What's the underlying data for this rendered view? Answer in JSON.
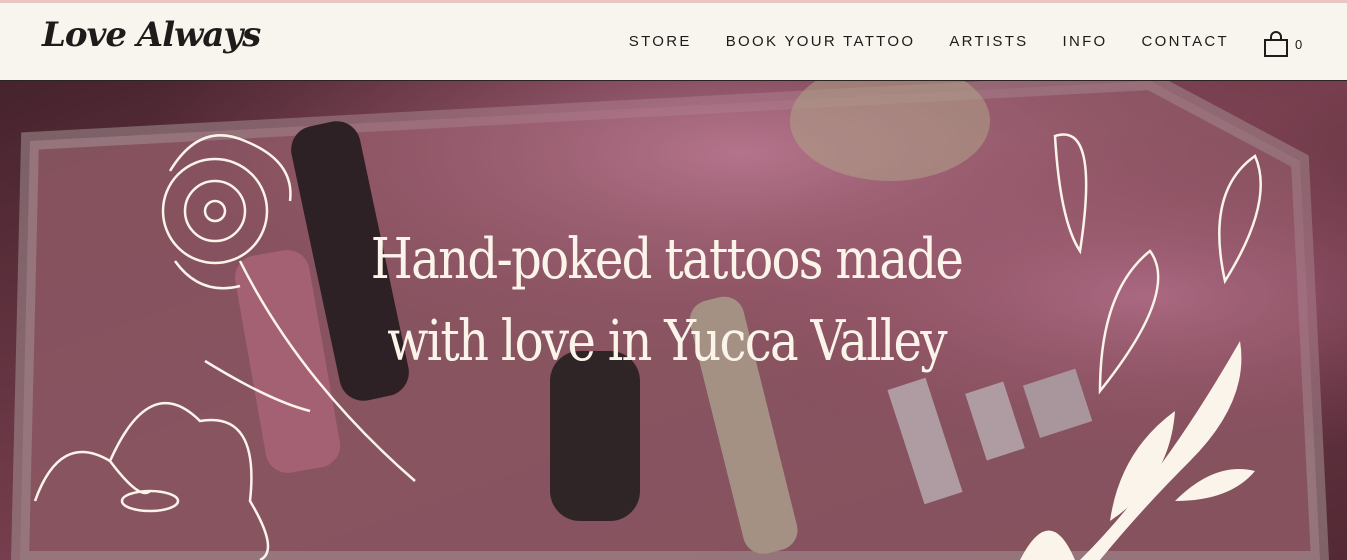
{
  "header": {
    "logo": "Love Always",
    "nav": [
      "STORE",
      "BOOK YOUR TATTOO",
      "ARTISTS",
      "INFO",
      "CONTACT"
    ],
    "cart_count": "0"
  },
  "hero": {
    "headline_line1": "Hand-poked tattoos made",
    "headline_line2": "with love in Yucca Valley"
  },
  "colors": {
    "cream": "#f8f4ee",
    "ink": "#1f1b1a",
    "headline": "#fbf4ea"
  },
  "icons": [
    "shopping-bag-icon",
    "flower-illustration",
    "leaf-illustration"
  ]
}
